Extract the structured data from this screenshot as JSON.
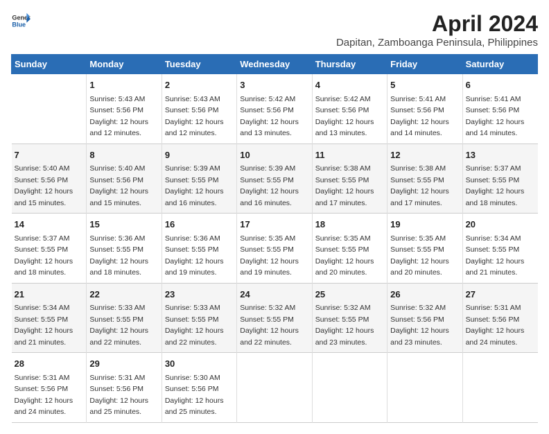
{
  "header": {
    "logo_general": "General",
    "logo_blue": "Blue",
    "title": "April 2024",
    "subtitle": "Dapitan, Zamboanga Peninsula, Philippines"
  },
  "calendar": {
    "days_of_week": [
      "Sunday",
      "Monday",
      "Tuesday",
      "Wednesday",
      "Thursday",
      "Friday",
      "Saturday"
    ],
    "weeks": [
      [
        {
          "day": "",
          "sunrise": "",
          "sunset": "",
          "daylight": ""
        },
        {
          "day": "1",
          "sunrise": "Sunrise: 5:43 AM",
          "sunset": "Sunset: 5:56 PM",
          "daylight": "Daylight: 12 hours and 12 minutes."
        },
        {
          "day": "2",
          "sunrise": "Sunrise: 5:43 AM",
          "sunset": "Sunset: 5:56 PM",
          "daylight": "Daylight: 12 hours and 12 minutes."
        },
        {
          "day": "3",
          "sunrise": "Sunrise: 5:42 AM",
          "sunset": "Sunset: 5:56 PM",
          "daylight": "Daylight: 12 hours and 13 minutes."
        },
        {
          "day": "4",
          "sunrise": "Sunrise: 5:42 AM",
          "sunset": "Sunset: 5:56 PM",
          "daylight": "Daylight: 12 hours and 13 minutes."
        },
        {
          "day": "5",
          "sunrise": "Sunrise: 5:41 AM",
          "sunset": "Sunset: 5:56 PM",
          "daylight": "Daylight: 12 hours and 14 minutes."
        },
        {
          "day": "6",
          "sunrise": "Sunrise: 5:41 AM",
          "sunset": "Sunset: 5:56 PM",
          "daylight": "Daylight: 12 hours and 14 minutes."
        }
      ],
      [
        {
          "day": "7",
          "sunrise": "Sunrise: 5:40 AM",
          "sunset": "Sunset: 5:56 PM",
          "daylight": "Daylight: 12 hours and 15 minutes."
        },
        {
          "day": "8",
          "sunrise": "Sunrise: 5:40 AM",
          "sunset": "Sunset: 5:56 PM",
          "daylight": "Daylight: 12 hours and 15 minutes."
        },
        {
          "day": "9",
          "sunrise": "Sunrise: 5:39 AM",
          "sunset": "Sunset: 5:55 PM",
          "daylight": "Daylight: 12 hours and 16 minutes."
        },
        {
          "day": "10",
          "sunrise": "Sunrise: 5:39 AM",
          "sunset": "Sunset: 5:55 PM",
          "daylight": "Daylight: 12 hours and 16 minutes."
        },
        {
          "day": "11",
          "sunrise": "Sunrise: 5:38 AM",
          "sunset": "Sunset: 5:55 PM",
          "daylight": "Daylight: 12 hours and 17 minutes."
        },
        {
          "day": "12",
          "sunrise": "Sunrise: 5:38 AM",
          "sunset": "Sunset: 5:55 PM",
          "daylight": "Daylight: 12 hours and 17 minutes."
        },
        {
          "day": "13",
          "sunrise": "Sunrise: 5:37 AM",
          "sunset": "Sunset: 5:55 PM",
          "daylight": "Daylight: 12 hours and 18 minutes."
        }
      ],
      [
        {
          "day": "14",
          "sunrise": "Sunrise: 5:37 AM",
          "sunset": "Sunset: 5:55 PM",
          "daylight": "Daylight: 12 hours and 18 minutes."
        },
        {
          "day": "15",
          "sunrise": "Sunrise: 5:36 AM",
          "sunset": "Sunset: 5:55 PM",
          "daylight": "Daylight: 12 hours and 18 minutes."
        },
        {
          "day": "16",
          "sunrise": "Sunrise: 5:36 AM",
          "sunset": "Sunset: 5:55 PM",
          "daylight": "Daylight: 12 hours and 19 minutes."
        },
        {
          "day": "17",
          "sunrise": "Sunrise: 5:35 AM",
          "sunset": "Sunset: 5:55 PM",
          "daylight": "Daylight: 12 hours and 19 minutes."
        },
        {
          "day": "18",
          "sunrise": "Sunrise: 5:35 AM",
          "sunset": "Sunset: 5:55 PM",
          "daylight": "Daylight: 12 hours and 20 minutes."
        },
        {
          "day": "19",
          "sunrise": "Sunrise: 5:35 AM",
          "sunset": "Sunset: 5:55 PM",
          "daylight": "Daylight: 12 hours and 20 minutes."
        },
        {
          "day": "20",
          "sunrise": "Sunrise: 5:34 AM",
          "sunset": "Sunset: 5:55 PM",
          "daylight": "Daylight: 12 hours and 21 minutes."
        }
      ],
      [
        {
          "day": "21",
          "sunrise": "Sunrise: 5:34 AM",
          "sunset": "Sunset: 5:55 PM",
          "daylight": "Daylight: 12 hours and 21 minutes."
        },
        {
          "day": "22",
          "sunrise": "Sunrise: 5:33 AM",
          "sunset": "Sunset: 5:55 PM",
          "daylight": "Daylight: 12 hours and 22 minutes."
        },
        {
          "day": "23",
          "sunrise": "Sunrise: 5:33 AM",
          "sunset": "Sunset: 5:55 PM",
          "daylight": "Daylight: 12 hours and 22 minutes."
        },
        {
          "day": "24",
          "sunrise": "Sunrise: 5:32 AM",
          "sunset": "Sunset: 5:55 PM",
          "daylight": "Daylight: 12 hours and 22 minutes."
        },
        {
          "day": "25",
          "sunrise": "Sunrise: 5:32 AM",
          "sunset": "Sunset: 5:55 PM",
          "daylight": "Daylight: 12 hours and 23 minutes."
        },
        {
          "day": "26",
          "sunrise": "Sunrise: 5:32 AM",
          "sunset": "Sunset: 5:56 PM",
          "daylight": "Daylight: 12 hours and 23 minutes."
        },
        {
          "day": "27",
          "sunrise": "Sunrise: 5:31 AM",
          "sunset": "Sunset: 5:56 PM",
          "daylight": "Daylight: 12 hours and 24 minutes."
        }
      ],
      [
        {
          "day": "28",
          "sunrise": "Sunrise: 5:31 AM",
          "sunset": "Sunset: 5:56 PM",
          "daylight": "Daylight: 12 hours and 24 minutes."
        },
        {
          "day": "29",
          "sunrise": "Sunrise: 5:31 AM",
          "sunset": "Sunset: 5:56 PM",
          "daylight": "Daylight: 12 hours and 25 minutes."
        },
        {
          "day": "30",
          "sunrise": "Sunrise: 5:30 AM",
          "sunset": "Sunset: 5:56 PM",
          "daylight": "Daylight: 12 hours and 25 minutes."
        },
        {
          "day": "",
          "sunrise": "",
          "sunset": "",
          "daylight": ""
        },
        {
          "day": "",
          "sunrise": "",
          "sunset": "",
          "daylight": ""
        },
        {
          "day": "",
          "sunrise": "",
          "sunset": "",
          "daylight": ""
        },
        {
          "day": "",
          "sunrise": "",
          "sunset": "",
          "daylight": ""
        }
      ]
    ]
  }
}
